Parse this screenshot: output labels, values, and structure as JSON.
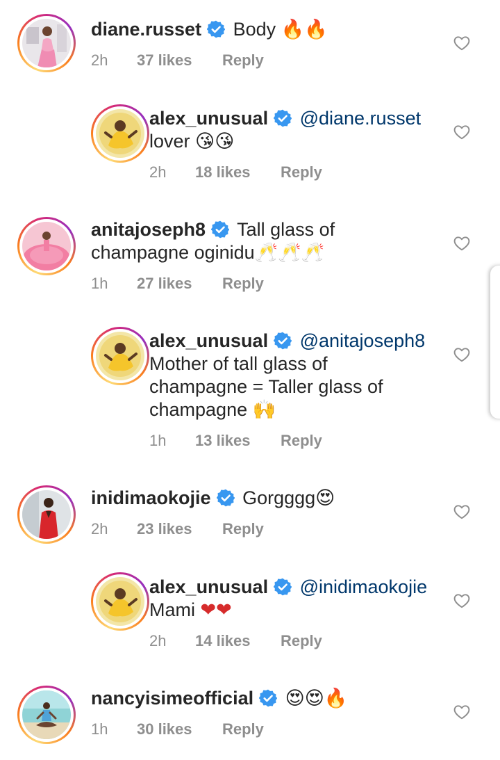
{
  "comments": [
    {
      "username": "diane.russet",
      "text": "Body",
      "emoji": "🔥🔥",
      "time": "2h",
      "likes": "37 likes",
      "reply": "Reply",
      "avatar": "woman-pink-dress-avatar"
    },
    {
      "username": "alex_unusual",
      "mention": "@diane.russet",
      "text": "lover",
      "emoji": "😘😘",
      "time": "2h",
      "likes": "18 likes",
      "reply": "Reply",
      "avatar": "yellow-outfit-avatar"
    },
    {
      "username": "anitajoseph8",
      "text_line1": "Tall glass of",
      "text_line2": "champagne oginidu",
      "emoji": "🥂🥂🥂",
      "time": "1h",
      "likes": "27 likes",
      "reply": "Reply",
      "avatar": "pink-ballgown-avatar"
    },
    {
      "username": "alex_unusual",
      "mention": "@anitajoseph8",
      "text_line1": "Mother of tall glass of",
      "text_line2": "champagne = Taller glass of",
      "text_line3": "champagne",
      "emoji": "🙌",
      "time": "1h",
      "likes": "13 likes",
      "reply": "Reply",
      "avatar": "yellow-outfit-avatar"
    },
    {
      "username": "inidimaokojie",
      "text": "Gorgggg",
      "emoji": "😍",
      "time": "2h",
      "likes": "23 likes",
      "reply": "Reply",
      "avatar": "red-suit-avatar"
    },
    {
      "username": "alex_unusual",
      "mention": "@inidimaokojie",
      "text": "Mami",
      "emoji": "❤❤",
      "time": "2h",
      "likes": "14 likes",
      "reply": "Reply",
      "avatar": "yellow-outfit-avatar"
    },
    {
      "username": "nancyisimeofficial",
      "text": "",
      "emoji": "😍😍🔥",
      "time": "1h",
      "likes": "30 likes",
      "reply": "Reply",
      "avatar": "yoga-pose-avatar"
    }
  ],
  "colors": {
    "verified": "#3897f0",
    "mention": "#00376b",
    "meta": "#8e8e8e",
    "text": "#262626"
  }
}
